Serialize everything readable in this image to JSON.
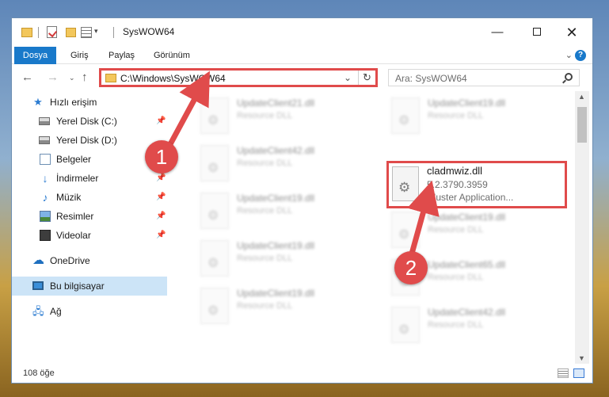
{
  "window": {
    "title": "SysWOW64",
    "controls": {
      "minimize": "—",
      "maximize": "",
      "close": "✕"
    }
  },
  "ribbon": {
    "tabs": [
      {
        "label": "Dosya",
        "active": true
      },
      {
        "label": "Giriş"
      },
      {
        "label": "Paylaş"
      },
      {
        "label": "Görünüm"
      }
    ],
    "help": "?"
  },
  "navigation": {
    "back": "←",
    "forward": "→",
    "recent": "⌄",
    "up": "↑",
    "address": "C:\\Windows\\SysWOW64",
    "address_chevron": "⌄",
    "refresh": "↻",
    "search_placeholder": "Ara: SysWOW64"
  },
  "sidebar": {
    "items": [
      {
        "label": "Hızlı erişim",
        "icon": "star-icon",
        "pinned": false
      },
      {
        "label": "Yerel Disk (C:)",
        "icon": "drive-icon",
        "pinned": true
      },
      {
        "label": "Yerel Disk (D:)",
        "icon": "drive-icon",
        "pinned": false
      },
      {
        "label": "Belgeler",
        "icon": "documents-icon",
        "pinned": true
      },
      {
        "label": "İndirmeler",
        "icon": "downloads-icon",
        "pinned": true
      },
      {
        "label": "Müzik",
        "icon": "music-icon",
        "pinned": true
      },
      {
        "label": "Resimler",
        "icon": "pictures-icon",
        "pinned": true
      },
      {
        "label": "Videolar",
        "icon": "videos-icon",
        "pinned": true
      },
      {
        "label": "OneDrive",
        "icon": "onedrive-icon",
        "pinned": false
      },
      {
        "label": "Bu bilgisayar",
        "icon": "this-pc-icon",
        "pinned": false,
        "selected": true
      },
      {
        "label": "Ağ",
        "icon": "network-icon",
        "pinned": false
      }
    ],
    "pin_glyph": "📌"
  },
  "files": [
    {
      "name": "UpdateClient21.dll",
      "type": "Resource DLL"
    },
    {
      "name": "UpdateClient19.dll",
      "type": "Resource DLL"
    },
    {
      "name": "UpdateClient42.dll",
      "type": "Resource DLL"
    },
    {
      "name": "UpdateClient19.dll",
      "type": "Resource DLL"
    },
    {
      "name": "UpdateClient19.dll",
      "type": "Resource DLL"
    },
    {
      "name": "UpdateClient65.dll",
      "type": "Resource DLL"
    },
    {
      "name": "UpdateClient19.dll",
      "type": "Resource DLL"
    },
    {
      "name": "UpdateClient42.dll",
      "type": "Resource DLL"
    },
    {
      "name": "UpdateClient19.dll",
      "type": "Resource DLL"
    }
  ],
  "highlighted_file": {
    "name": "cladmwiz.dll",
    "version": "5.2.3790.3959",
    "description": "Cluster Application..."
  },
  "status": {
    "item_count": "108 öğe"
  },
  "annotations": {
    "step1": "1",
    "step2": "2",
    "color": "#e04b4b"
  },
  "scrollbar": {
    "up": "▲",
    "down": "▼"
  }
}
